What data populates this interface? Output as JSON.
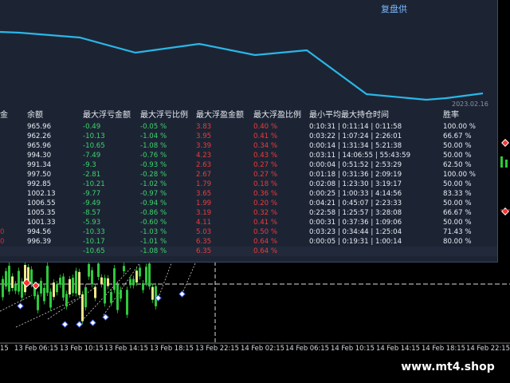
{
  "panel": {
    "title": "复盘供",
    "curve_date": "2023.02.16"
  },
  "table": {
    "headers": [
      "金",
      "余额",
      "最大浮亏金额",
      "最大浮亏比例",
      "最大浮盈金额",
      "最大浮盈比例",
      "最小平均最大持仓时间",
      "胜率"
    ],
    "rows": [
      [
        "",
        "965.96",
        "-0.49",
        "-0.05 %",
        "3.83",
        "0.40 %",
        "0:10:31 | 0:11:14 | 0:11:58",
        "100.00 %"
      ],
      [
        "",
        "962.26",
        "-10.13",
        "-1.04 %",
        "3.95",
        "0.41 %",
        "0:03:22 | 1:07:24 | 2:26:01",
        "66.67 %"
      ],
      [
        "",
        "965.96",
        "-10.65",
        "-1.08 %",
        "3.39",
        "0.34 %",
        "0:00:14 | 1:31:34 | 5:21:38",
        "50.00 %"
      ],
      [
        "",
        "994.30",
        "-7.49",
        "-0.76 %",
        "4.23",
        "0.43 %",
        "0:03:11 | 14:06:55 | 55:43:59",
        "50.00 %"
      ],
      [
        "",
        "991.34",
        "-9.3",
        "-0.93 %",
        "2.63",
        "0.27 %",
        "0:00:04 | 0:51:52 | 2:53:29",
        "62.50 %"
      ],
      [
        "",
        "997.50",
        "-2.81",
        "-0.28 %",
        "2.67",
        "0.27 %",
        "0:01:18 | 0:31:36 | 2:09:19",
        "100.00 %"
      ],
      [
        "",
        "992.85",
        "-10.21",
        "-1.02 %",
        "1.79",
        "0.18 %",
        "0:02:08 | 1:23:30 | 3:19:17",
        "50.00 %"
      ],
      [
        "",
        "1002.13",
        "-9.77",
        "-0.97 %",
        "3.65",
        "0.36 %",
        "0:00:25 | 1:00:33 | 4:14:56",
        "83.33 %"
      ],
      [
        "",
        "1006.55",
        "-9.49",
        "-0.94 %",
        "1.99",
        "0.20 %",
        "0:04:21 | 0:45:07 | 2:23:33",
        "50.00 %"
      ],
      [
        "",
        "1005.35",
        "-8.57",
        "-0.86 %",
        "3.19",
        "0.32 %",
        "0:22:58 | 1:25:57 | 3:28:08",
        "66.67 %"
      ],
      [
        "",
        "1001.33",
        "-5.93",
        "-0.60 %",
        "4.11",
        "0.41 %",
        "0:00:31 | 0:37:36 | 1:09:06",
        "50.00 %"
      ],
      [
        "0",
        "994.56",
        "-10.33",
        "-1.03 %",
        "5.03",
        "0.50 %",
        "0:03:23 | 0:34:44 | 1:25:04",
        "71.43 %"
      ],
      [
        "0",
        "996.39",
        "-10.17",
        "-1.01 %",
        "6.35",
        "0.64 %",
        "0:00:05 | 0:19:31 | 1:00:14",
        "80.00 %"
      ],
      [
        "",
        "",
        "-10.65",
        "-1.08 %",
        "6.35",
        "0.64 %",
        "",
        ""
      ]
    ]
  },
  "time_axis": [
    "15",
    "13 Feb 06:15",
    "13 Feb 10:15",
    "13 Feb 14:15",
    "13 Feb 18:15",
    "13 Feb 22:15",
    "14 Feb 02:15",
    "14 Feb 06:15",
    "14 Feb 10:15",
    "14 Feb 14:15",
    "14 Feb 18:15",
    "14 Feb 22:15"
  ],
  "watermark": "www.mt4.shop",
  "colors": {
    "curve": "#2bb6e6",
    "candle": "#2fc83c",
    "panel_bg": "#1c2434",
    "loss": "#3ed36b",
    "profit": "#ee3a3a"
  }
}
